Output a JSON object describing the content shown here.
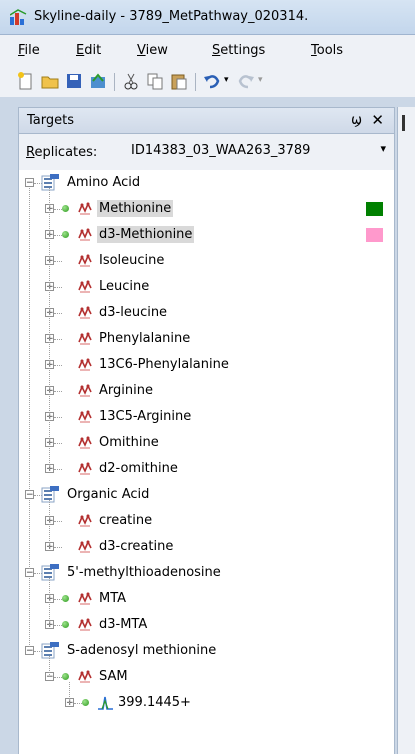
{
  "window": {
    "title": "Skyline-daily - 3789_MetPathway_020314."
  },
  "menu": [
    {
      "u": "F",
      "rest": "ile"
    },
    {
      "u": "E",
      "rest": "dit"
    },
    {
      "u": "V",
      "rest": "iew"
    },
    {
      "u": "S",
      "rest": "ettings"
    },
    {
      "u": "T",
      "rest": "ools"
    }
  ],
  "targets": {
    "title": "Targets",
    "pin_glyph": "ϣ",
    "close_glyph": "✕",
    "replicates_label_u": "R",
    "replicates_label_rest": "eplicates:",
    "replicate_value": "ID14383_03_WAA263_3789",
    "dropdown_glyph": "▾"
  },
  "tree": [
    {
      "kind": "group",
      "label": "Amino Acid"
    },
    {
      "kind": "mol",
      "label": "Methionine",
      "dot": true,
      "selected": true,
      "swatch": "#008000"
    },
    {
      "kind": "mol",
      "label": "d3-Methionine",
      "dot": true,
      "selected": true,
      "swatch": "#ff99cc"
    },
    {
      "kind": "mol",
      "label": "Isoleucine"
    },
    {
      "kind": "mol",
      "label": "Leucine"
    },
    {
      "kind": "mol",
      "label": "d3-leucine"
    },
    {
      "kind": "mol",
      "label": "Phenylalanine"
    },
    {
      "kind": "mol",
      "label": "13C6-Phenylalanine"
    },
    {
      "kind": "mol",
      "label": "Arginine"
    },
    {
      "kind": "mol",
      "label": "13C5-Arginine"
    },
    {
      "kind": "mol",
      "label": "Omithine"
    },
    {
      "kind": "mol",
      "label": "d2-omithine"
    },
    {
      "kind": "group",
      "label": "Organic Acid"
    },
    {
      "kind": "mol",
      "label": "creatine"
    },
    {
      "kind": "mol",
      "label": "d3-creatine"
    },
    {
      "kind": "group",
      "label": "5'-methylthioadenosine"
    },
    {
      "kind": "mol",
      "label": "MTA",
      "dot": true
    },
    {
      "kind": "mol",
      "label": "d3-MTA",
      "dot": true
    },
    {
      "kind": "group",
      "label": "S-adenosyl methionine"
    },
    {
      "kind": "mol",
      "label": "SAM",
      "dot": true,
      "expanded": true
    },
    {
      "kind": "precursor",
      "label": "399.1445+",
      "dot": true
    }
  ],
  "colors": {
    "accent_green": "#008000",
    "accent_pink": "#ff99cc",
    "peptide_red": "#b33030"
  },
  "icons": [
    "app-logo-icon",
    "new-icon",
    "open-icon",
    "save-icon",
    "publish-icon",
    "cut-icon",
    "copy-icon",
    "paste-icon",
    "undo-icon",
    "redo-icon"
  ]
}
